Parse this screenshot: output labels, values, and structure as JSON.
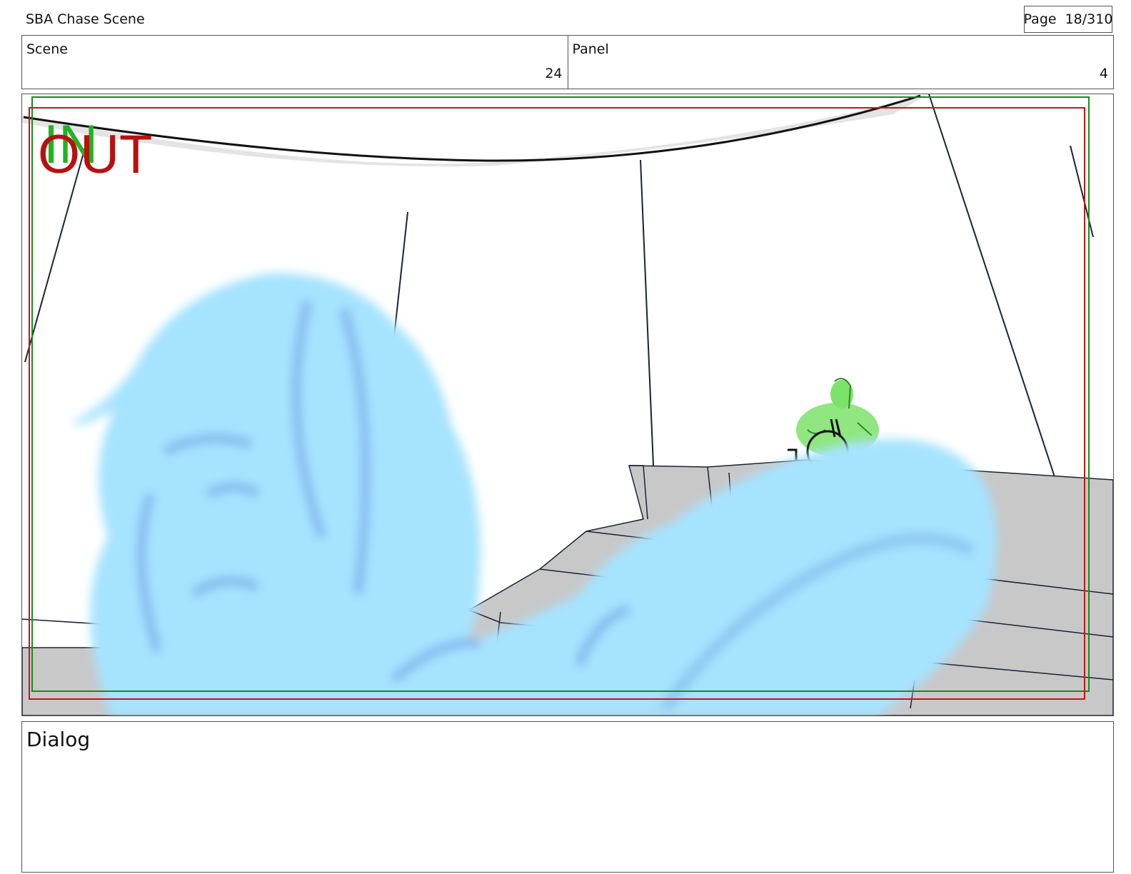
{
  "header": {
    "title": "SBA Chase Scene",
    "page_label": "Page",
    "page_value": "18/310"
  },
  "info": {
    "scene_label": "Scene",
    "scene_value": "24",
    "panel_label": "Panel",
    "panel_value": "4"
  },
  "panel": {
    "in_marker": "IN",
    "out_marker": "OUT",
    "colors": {
      "in_frame": "#1a8a1a",
      "out_frame": "#c01818",
      "ghost": "#a6e3ff",
      "character": "#7de26a",
      "ship": "#c8c8c8"
    }
  },
  "dialog": {
    "label": "Dialog",
    "text": ""
  }
}
